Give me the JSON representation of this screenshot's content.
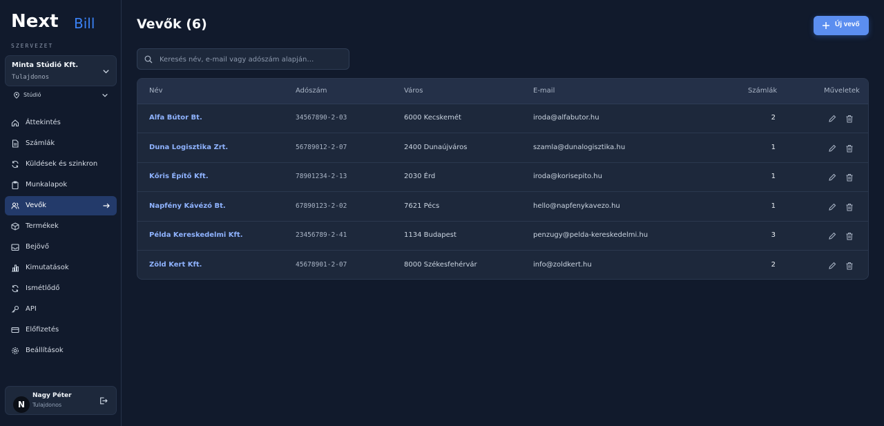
{
  "brand": {
    "logo_text_main": "Next",
    "logo_text_sub": "Bill"
  },
  "sidebar": {
    "org_caption": "SZERVEZET",
    "org": {
      "name": "Minta Stúdió Kft.",
      "role": "Tulajdonos"
    },
    "workspace": "Stúdió",
    "items": [
      {
        "label": "Áttekintés",
        "icon": "dashboard-icon"
      },
      {
        "label": "Számlák",
        "icon": "file-icon"
      },
      {
        "label": "Küldések és szinkron",
        "icon": "sync-icon"
      },
      {
        "label": "Munkalapok",
        "icon": "clipboard-icon"
      },
      {
        "label": "Vevők",
        "icon": "users-icon",
        "active": true
      },
      {
        "label": "Termékek",
        "icon": "box-icon"
      },
      {
        "label": "Bejövő",
        "icon": "inbox-icon"
      },
      {
        "label": "Kimutatások",
        "icon": "bar-chart-icon"
      },
      {
        "label": "Ismétlődő",
        "icon": "repeat-icon"
      },
      {
        "label": "API",
        "icon": "key-icon"
      },
      {
        "label": "Előfizetés",
        "icon": "credit-card-icon"
      },
      {
        "label": "Beállítások",
        "icon": "gear-icon"
      }
    ],
    "user": {
      "initial": "N",
      "name": "Nagy Péter",
      "role": "Tulajdonos"
    }
  },
  "main": {
    "title": "Vevők (6)",
    "new_button": "Új vevő",
    "search_placeholder": "Keresés név, e-mail vagy adószám alapján…",
    "columns": {
      "name": "Név",
      "tax": "Adószám",
      "city": "Város",
      "email": "E-mail",
      "invoices": "Számlák",
      "actions": "Műveletek"
    },
    "rows": [
      {
        "name": "Alfa Bútor Bt.",
        "tax": "34567890-2-03",
        "city": "6000 Kecskemét",
        "email": "iroda@alfabutor.hu",
        "invoices": "2"
      },
      {
        "name": "Duna Logisztika Zrt.",
        "tax": "56789012-2-07",
        "city": "2400 Dunaújváros",
        "email": "szamla@dunalogisztika.hu",
        "invoices": "1"
      },
      {
        "name": "Kőris Építő Kft.",
        "tax": "78901234-2-13",
        "city": "2030 Érd",
        "email": "iroda@korisepito.hu",
        "invoices": "1"
      },
      {
        "name": "Napfény Kávézó Bt.",
        "tax": "67890123-2-02",
        "city": "7621 Pécs",
        "email": "hello@napfenykavezo.hu",
        "invoices": "1"
      },
      {
        "name": "Példa Kereskedelmi Kft.",
        "tax": "23456789-2-41",
        "city": "1134 Budapest",
        "email": "penzugy@pelda-kereskedelmi.hu",
        "invoices": "3"
      },
      {
        "name": "Zöld Kert Kft.",
        "tax": "45678901-2-07",
        "city": "8000 Székesfehérvár",
        "email": "info@zoldkert.hu",
        "invoices": "2"
      }
    ]
  },
  "colors": {
    "accent": "#5b8ef0",
    "link": "#8fb3ff",
    "active_nav": "#233a6a",
    "background": "#111a2c"
  }
}
